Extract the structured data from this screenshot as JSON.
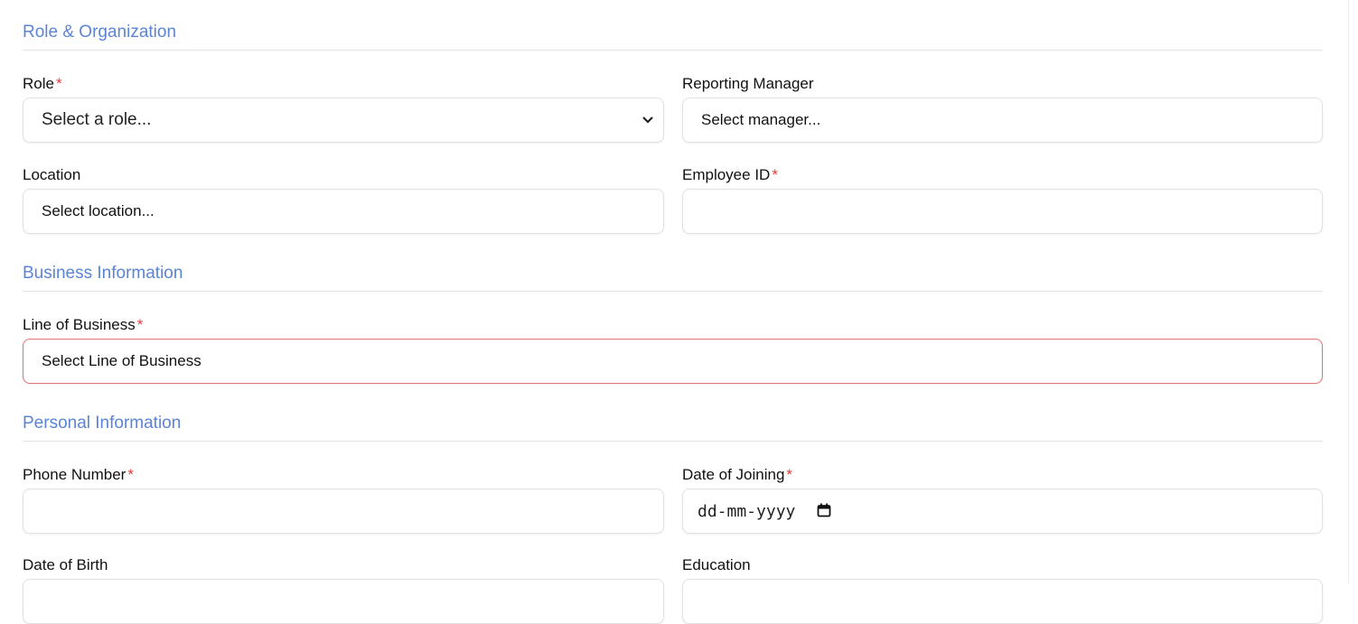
{
  "sections": {
    "role_org": "Role & Organization",
    "business": "Business Information",
    "personal": "Personal Information"
  },
  "fields": {
    "role": {
      "label": "Role",
      "required": "*",
      "placeholder": "Select a role..."
    },
    "manager": {
      "label": "Reporting Manager",
      "placeholder": "Select manager..."
    },
    "location": {
      "label": "Location",
      "placeholder": "Select location..."
    },
    "employee_id": {
      "label": "Employee ID",
      "required": "*",
      "value": ""
    },
    "line_of_business": {
      "label": "Line of Business",
      "required": "*",
      "placeholder": "Select Line of Business"
    },
    "phone": {
      "label": "Phone Number",
      "required": "*",
      "value": ""
    },
    "date_of_joining": {
      "label": "Date of Joining",
      "required": "*",
      "placeholder": "dd-mm-yyyy"
    },
    "date_of_birth": {
      "label": "Date of Birth"
    },
    "education": {
      "label": "Education"
    }
  },
  "icons": {
    "role_chevron": "chevron-down-icon",
    "date_calendar": "calendar-icon"
  },
  "colors": {
    "section_title": "#5b84d6",
    "required": "#e53935",
    "error_border": "#e57373"
  }
}
